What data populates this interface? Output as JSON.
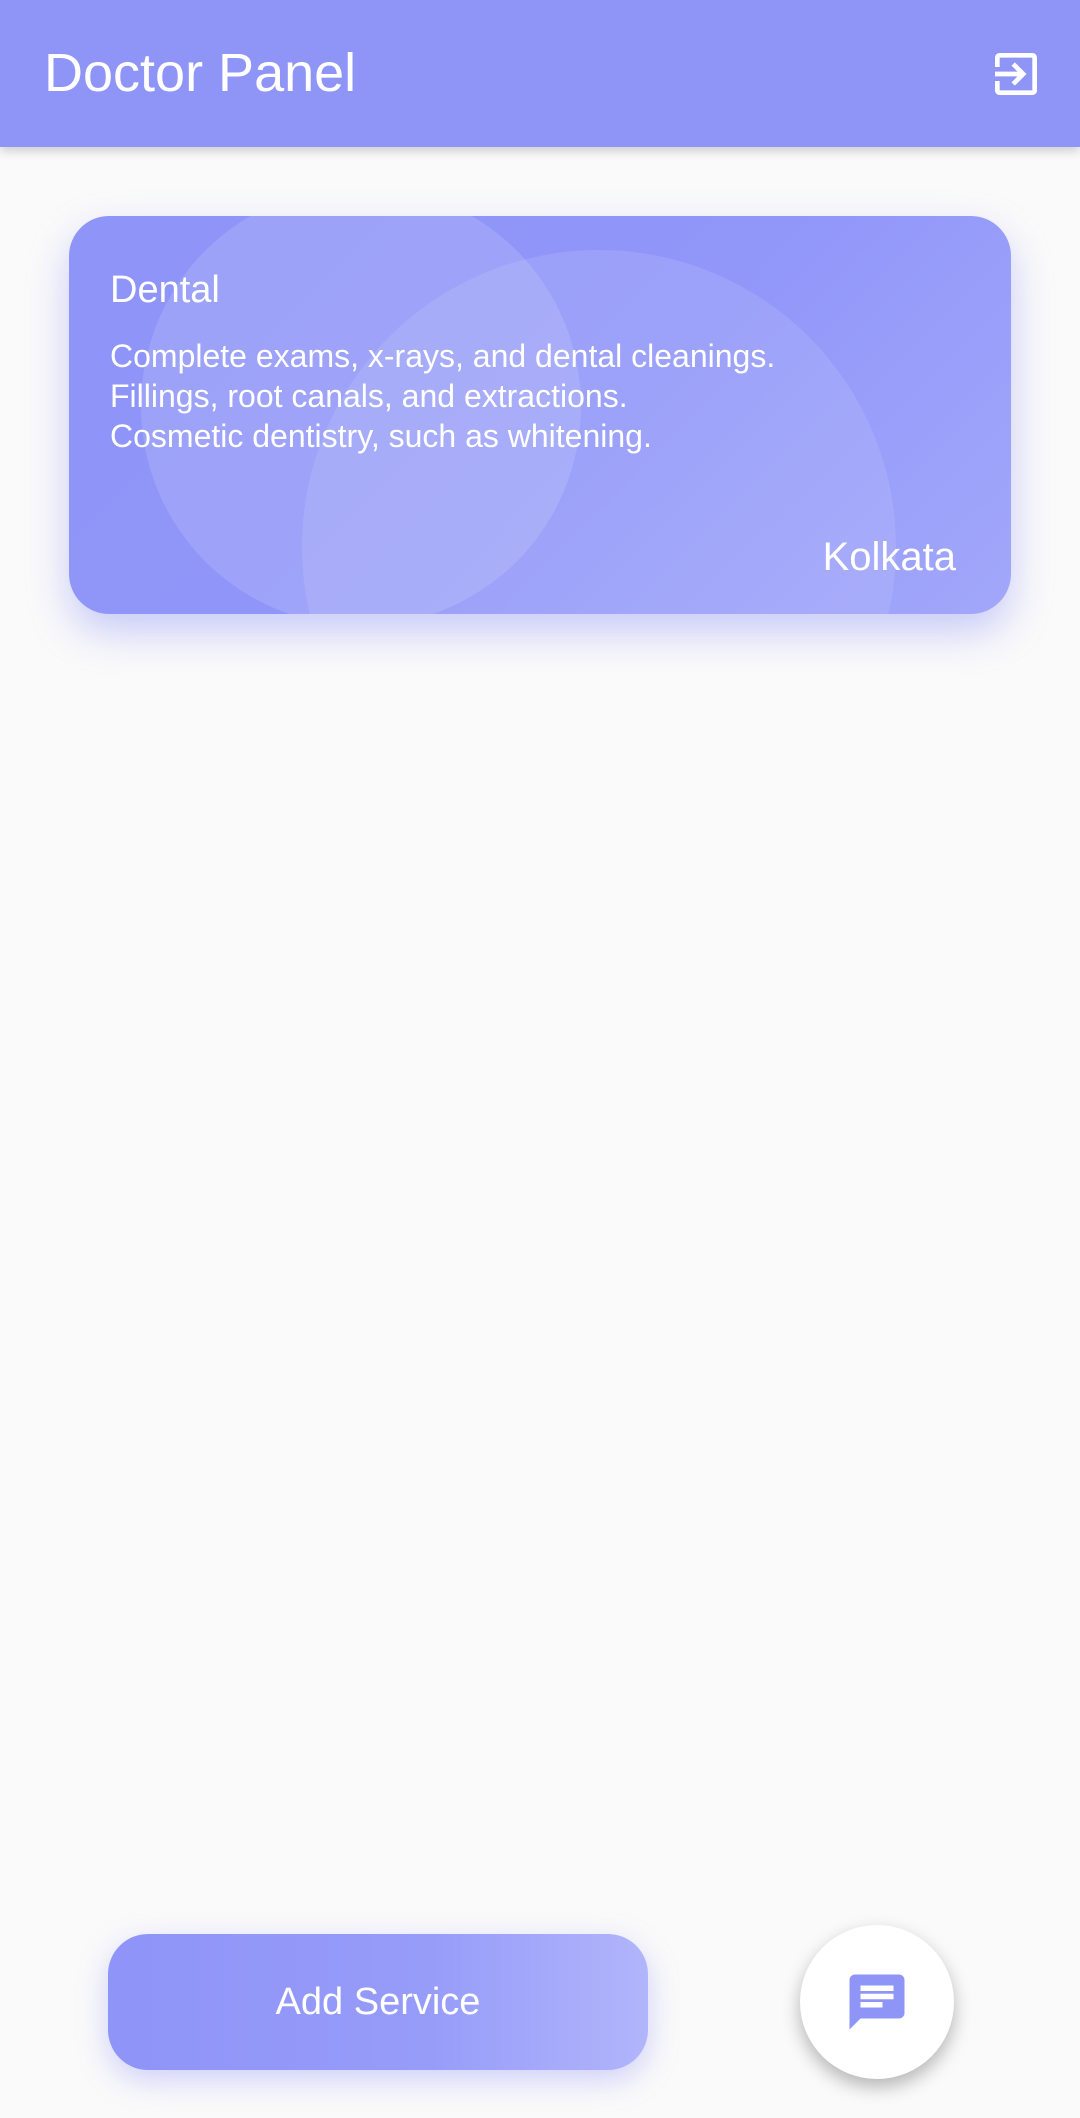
{
  "app_bar": {
    "title": "Doctor Panel",
    "logout_icon": "logout-icon"
  },
  "services": [
    {
      "title": "Dental",
      "description_lines": [
        "Complete exams, x-rays, and dental cleanings.",
        "Fillings, root canals, and extractions.",
        "Cosmetic dentistry, such as whitening."
      ],
      "location": "Kolkata"
    }
  ],
  "actions": {
    "add_service_label": "Add Service",
    "chat_icon": "chat-icon"
  },
  "colors": {
    "primary": "#8f95f7",
    "background": "#fafafa",
    "fab_background": "#ffffff",
    "text_on_primary": "#ffffff"
  }
}
